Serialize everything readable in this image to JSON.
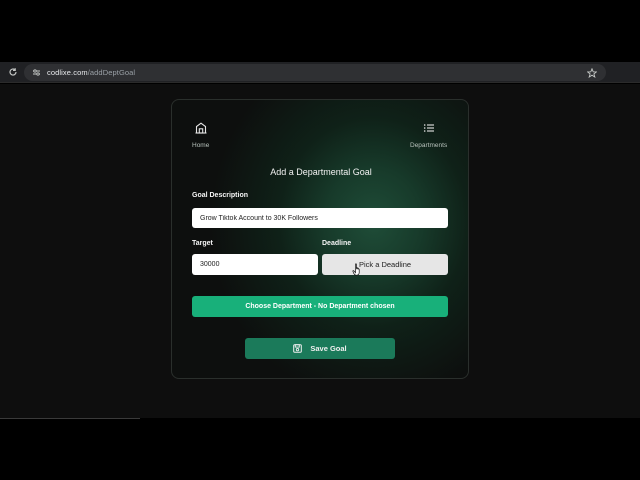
{
  "browser": {
    "url_host": "codlixe.com",
    "url_path": "/addDeptGoal",
    "icons": [
      "reload-icon",
      "site-settings-icon",
      "bookmark-star-icon",
      "extensions-icon"
    ]
  },
  "nav": {
    "home_label": "Home",
    "departments_label": "Departments",
    "icons": [
      "home-icon",
      "list-icon"
    ]
  },
  "form": {
    "title": "Add a Departmental Goal",
    "goal_description_label": "Goal Description",
    "goal_description_value": "Grow Tiktok Account to 30K Followers",
    "target_label": "Target",
    "target_value": "30000",
    "deadline_label": "Deadline",
    "deadline_button": "Pick a Deadline",
    "department_button": "Choose Department - No Department chosen",
    "save_button": "Save Goal"
  },
  "colors": {
    "accent_green": "#18b07a",
    "save_green": "#1b7a5a",
    "card_glow": "#1f4d38"
  }
}
